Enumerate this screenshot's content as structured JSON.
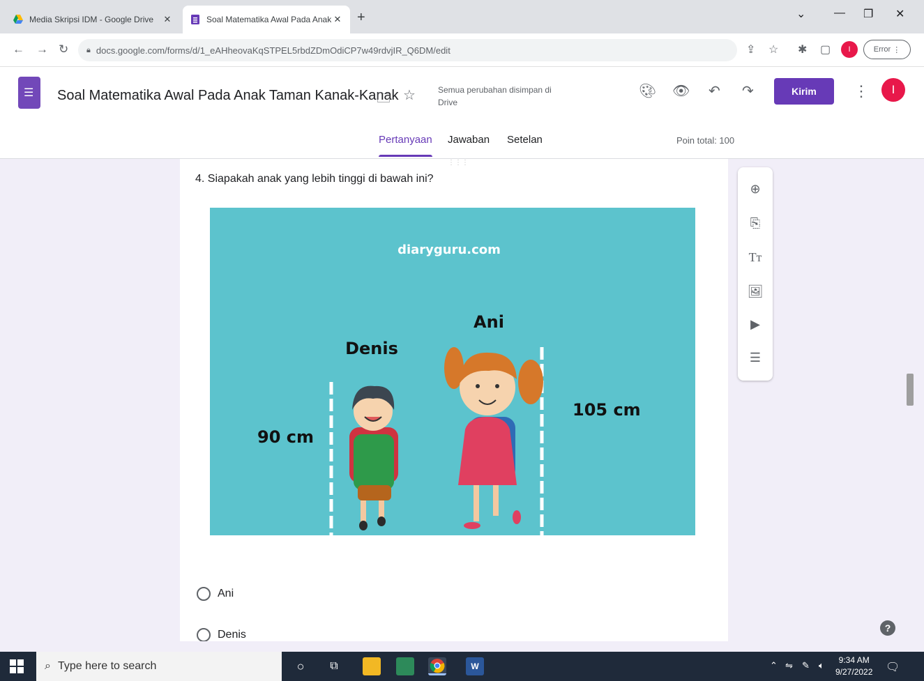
{
  "browser": {
    "tabs": [
      {
        "title": "Media Skripsi IDM - Google Drive",
        "active": false,
        "icon": "google-drive-icon"
      },
      {
        "title": "Soal Matematika Awal Pada Anak",
        "active": true,
        "icon": "google-forms-icon"
      }
    ],
    "url": "docs.google.com/forms/d/1_eAHheovaKqSTPEL5rbdZDmOdiCP7w49rdvjIR_Q6DM/edit",
    "profile_initial": "I",
    "error_label": "Error"
  },
  "form": {
    "title": "Soal Matematika Awal Pada Anak Taman Kanak-Kanak",
    "save_status": "Semua perubahan disimpan di Drive",
    "send_label": "Kirim",
    "avatar_initial": "I",
    "tabs": [
      {
        "label": "Pertanyaan",
        "active": true
      },
      {
        "label": "Jawaban",
        "active": false
      },
      {
        "label": "Setelan",
        "active": false
      }
    ],
    "points_label": "Poin total: 100",
    "accent_color": "#673ab7"
  },
  "question": {
    "text": "4. Siapakah anak yang lebih tinggi di bawah ini?",
    "image": {
      "watermark": "diaryguru.com",
      "label_denis": "Denis",
      "label_ani": "Ani",
      "height_denis": "90 cm",
      "height_ani": "105 cm",
      "background_color": "#5cc3cd"
    },
    "options": [
      "Ani",
      "Denis"
    ]
  },
  "side_tools": [
    "add-question-icon",
    "import-questions-icon",
    "add-title-icon",
    "add-image-icon",
    "add-video-icon",
    "add-section-icon"
  ],
  "taskbar": {
    "search_placeholder": "Type here to search",
    "time": "9:34 AM",
    "date": "9/27/2022"
  }
}
